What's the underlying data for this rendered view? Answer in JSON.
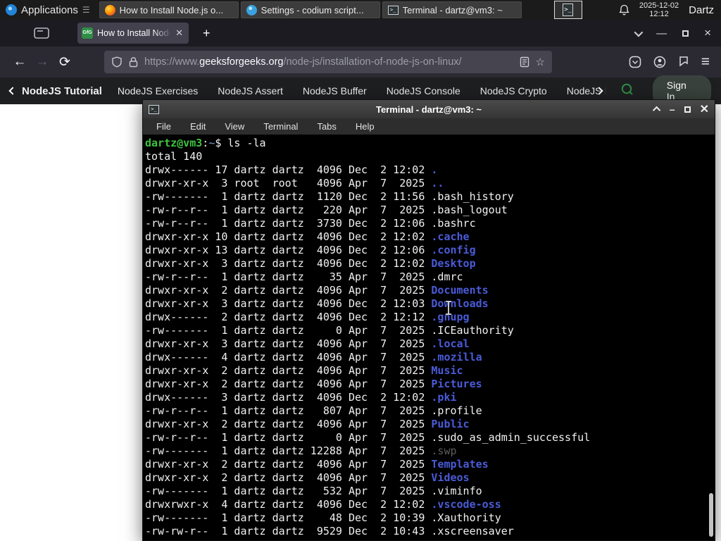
{
  "panel": {
    "applications_label": "Applications",
    "windows": [
      {
        "label": "How to Install Node.js o...",
        "app": "firefox"
      },
      {
        "label": "Settings - codium script...",
        "app": "codium"
      },
      {
        "label": "Terminal - dartz@vm3: ~",
        "app": "terminal"
      }
    ],
    "clock": {
      "date": "2025-12-02",
      "time": "12:12"
    },
    "user": "Dartz"
  },
  "browser": {
    "tab": {
      "title": "How to Install Node.js on",
      "favicon_text": "GfG"
    },
    "url": {
      "prefix": "https://www.",
      "domain": "geeksforgeeks.org",
      "path": "/node-js/installation-of-node-js-on-linux/"
    }
  },
  "site_nav": {
    "back_item": "NodeJS Tutorial",
    "items": [
      "NodeJS Exercises",
      "NodeJS Assert",
      "NodeJS Buffer",
      "NodeJS Console",
      "NodeJS Crypto",
      "NodeJS DNS",
      "NodeJS"
    ],
    "sign_in": "Sign In"
  },
  "terminal": {
    "title": "Terminal - dartz@vm3: ~",
    "menu": [
      "File",
      "Edit",
      "View",
      "Terminal",
      "Tabs",
      "Help"
    ],
    "prompt": {
      "user_host": "dartz@vm3",
      "separator": ":",
      "cwd": "~",
      "dollar": "$ ",
      "command": "ls -la"
    },
    "total_line": "total 140",
    "rows": [
      {
        "perms": "drwx------",
        "links": "17",
        "owner": "dartz",
        "group": "dartz",
        "size": "4096",
        "month": "Dec",
        "day": "2",
        "time": "12:02",
        "name": ".",
        "type": "dir"
      },
      {
        "perms": "drwxr-xr-x",
        "links": "3",
        "owner": "root",
        "group": "root",
        "size": "4096",
        "month": "Apr",
        "day": "7",
        "time": "2025",
        "name": "..",
        "type": "dir"
      },
      {
        "perms": "-rw-------",
        "links": "1",
        "owner": "dartz",
        "group": "dartz",
        "size": "1120",
        "month": "Dec",
        "day": "2",
        "time": "11:56",
        "name": ".bash_history",
        "type": "file"
      },
      {
        "perms": "-rw-r--r--",
        "links": "1",
        "owner": "dartz",
        "group": "dartz",
        "size": "220",
        "month": "Apr",
        "day": "7",
        "time": "2025",
        "name": ".bash_logout",
        "type": "file"
      },
      {
        "perms": "-rw-r--r--",
        "links": "1",
        "owner": "dartz",
        "group": "dartz",
        "size": "3730",
        "month": "Dec",
        "day": "2",
        "time": "12:06",
        "name": ".bashrc",
        "type": "file"
      },
      {
        "perms": "drwxr-xr-x",
        "links": "10",
        "owner": "dartz",
        "group": "dartz",
        "size": "4096",
        "month": "Dec",
        "day": "2",
        "time": "12:02",
        "name": ".cache",
        "type": "dir"
      },
      {
        "perms": "drwxr-xr-x",
        "links": "13",
        "owner": "dartz",
        "group": "dartz",
        "size": "4096",
        "month": "Dec",
        "day": "2",
        "time": "12:06",
        "name": ".config",
        "type": "dir"
      },
      {
        "perms": "drwxr-xr-x",
        "links": "3",
        "owner": "dartz",
        "group": "dartz",
        "size": "4096",
        "month": "Dec",
        "day": "2",
        "time": "12:02",
        "name": "Desktop",
        "type": "dir"
      },
      {
        "perms": "-rw-r--r--",
        "links": "1",
        "owner": "dartz",
        "group": "dartz",
        "size": "35",
        "month": "Apr",
        "day": "7",
        "time": "2025",
        "name": ".dmrc",
        "type": "file"
      },
      {
        "perms": "drwxr-xr-x",
        "links": "2",
        "owner": "dartz",
        "group": "dartz",
        "size": "4096",
        "month": "Apr",
        "day": "7",
        "time": "2025",
        "name": "Documents",
        "type": "dir"
      },
      {
        "perms": "drwxr-xr-x",
        "links": "3",
        "owner": "dartz",
        "group": "dartz",
        "size": "4096",
        "month": "Dec",
        "day": "2",
        "time": "12:03",
        "name": "Downloads",
        "type": "dir"
      },
      {
        "perms": "drwx------",
        "links": "2",
        "owner": "dartz",
        "group": "dartz",
        "size": "4096",
        "month": "Dec",
        "day": "2",
        "time": "12:12",
        "name": ".gnupg",
        "type": "dir"
      },
      {
        "perms": "-rw-------",
        "links": "1",
        "owner": "dartz",
        "group": "dartz",
        "size": "0",
        "month": "Apr",
        "day": "7",
        "time": "2025",
        "name": ".ICEauthority",
        "type": "file"
      },
      {
        "perms": "drwxr-xr-x",
        "links": "3",
        "owner": "dartz",
        "group": "dartz",
        "size": "4096",
        "month": "Apr",
        "day": "7",
        "time": "2025",
        "name": ".local",
        "type": "dir"
      },
      {
        "perms": "drwx------",
        "links": "4",
        "owner": "dartz",
        "group": "dartz",
        "size": "4096",
        "month": "Apr",
        "day": "7",
        "time": "2025",
        "name": ".mozilla",
        "type": "dir"
      },
      {
        "perms": "drwxr-xr-x",
        "links": "2",
        "owner": "dartz",
        "group": "dartz",
        "size": "4096",
        "month": "Apr",
        "day": "7",
        "time": "2025",
        "name": "Music",
        "type": "dir"
      },
      {
        "perms": "drwxr-xr-x",
        "links": "2",
        "owner": "dartz",
        "group": "dartz",
        "size": "4096",
        "month": "Apr",
        "day": "7",
        "time": "2025",
        "name": "Pictures",
        "type": "dir"
      },
      {
        "perms": "drwx------",
        "links": "3",
        "owner": "dartz",
        "group": "dartz",
        "size": "4096",
        "month": "Dec",
        "day": "2",
        "time": "12:02",
        "name": ".pki",
        "type": "dir"
      },
      {
        "perms": "-rw-r--r--",
        "links": "1",
        "owner": "dartz",
        "group": "dartz",
        "size": "807",
        "month": "Apr",
        "day": "7",
        "time": "2025",
        "name": ".profile",
        "type": "file"
      },
      {
        "perms": "drwxr-xr-x",
        "links": "2",
        "owner": "dartz",
        "group": "dartz",
        "size": "4096",
        "month": "Apr",
        "day": "7",
        "time": "2025",
        "name": "Public",
        "type": "dir"
      },
      {
        "perms": "-rw-r--r--",
        "links": "1",
        "owner": "dartz",
        "group": "dartz",
        "size": "0",
        "month": "Apr",
        "day": "7",
        "time": "2025",
        "name": ".sudo_as_admin_successful",
        "type": "file"
      },
      {
        "perms": "-rw-------",
        "links": "1",
        "owner": "dartz",
        "group": "dartz",
        "size": "12288",
        "month": "Apr",
        "day": "7",
        "time": "2025",
        "name": ".swp",
        "type": "dim"
      },
      {
        "perms": "drwxr-xr-x",
        "links": "2",
        "owner": "dartz",
        "group": "dartz",
        "size": "4096",
        "month": "Apr",
        "day": "7",
        "time": "2025",
        "name": "Templates",
        "type": "dir"
      },
      {
        "perms": "drwxr-xr-x",
        "links": "2",
        "owner": "dartz",
        "group": "dartz",
        "size": "4096",
        "month": "Apr",
        "day": "7",
        "time": "2025",
        "name": "Videos",
        "type": "dir"
      },
      {
        "perms": "-rw-------",
        "links": "1",
        "owner": "dartz",
        "group": "dartz",
        "size": "532",
        "month": "Apr",
        "day": "7",
        "time": "2025",
        "name": ".viminfo",
        "type": "file"
      },
      {
        "perms": "drwxrwxr-x",
        "links": "4",
        "owner": "dartz",
        "group": "dartz",
        "size": "4096",
        "month": "Dec",
        "day": "2",
        "time": "12:02",
        "name": ".vscode-oss",
        "type": "dir"
      },
      {
        "perms": "-rw-------",
        "links": "1",
        "owner": "dartz",
        "group": "dartz",
        "size": "48",
        "month": "Dec",
        "day": "2",
        "time": "10:39",
        "name": ".Xauthority",
        "type": "file"
      },
      {
        "perms": "-rw-rw-r--",
        "links": "1",
        "owner": "dartz",
        "group": "dartz",
        "size": "9529",
        "month": "Dec",
        "day": "2",
        "time": "10:43",
        "name": ".xscreensaver",
        "type": "file"
      }
    ]
  },
  "colors": {
    "dir_blue": "#4a5bd8",
    "prompt_green": "#3fc43f",
    "path_blue": "#729fcf",
    "gfg_green": "#2f8d46",
    "panel_bg": "#1b1b1b",
    "terminal_bg": "#000000"
  }
}
